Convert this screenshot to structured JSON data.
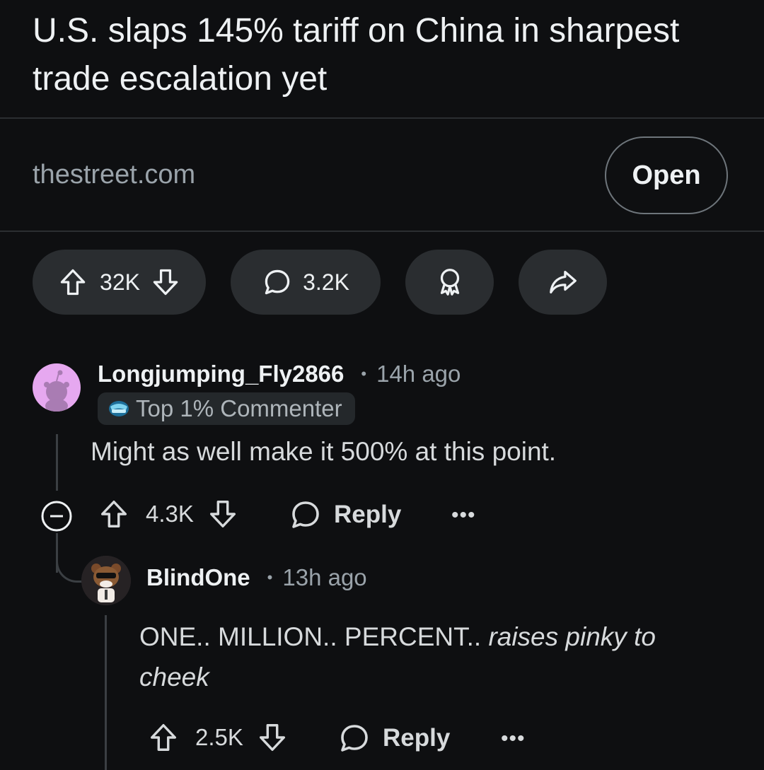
{
  "post": {
    "title": "U.S. slaps 145% tariff on China in sharpest trade escalation yet",
    "domain": "thestreet.com",
    "open_label": "Open",
    "votes": "32K",
    "comments": "3.2K"
  },
  "comments": [
    {
      "username": "Longjumping_Fly2866",
      "time": "14h ago",
      "badge": "Top 1% Commenter",
      "body": "Might as well make it 500% at this point.",
      "votes": "4.3K",
      "reply_label": "Reply",
      "more": "•••"
    },
    {
      "username": "BlindOne",
      "time": "13h ago",
      "body_plain": "ONE.. MILLION.. PERCENT.. ",
      "body_italic_1": "raises pinky to",
      "body_italic_2": "cheek",
      "votes": "2.5K",
      "reply_label": "Reply",
      "more": "•••"
    }
  ],
  "colors": {
    "background": "#0e0f11",
    "pill": "#2a2d30",
    "avatar1_bg": "#e6a8f0",
    "badge_icon": "#7fd4f0"
  },
  "icons": [
    "upvote-icon",
    "downvote-icon",
    "comment-icon",
    "award-icon",
    "share-icon",
    "collapse-icon",
    "ellipsis-icon",
    "snoo-avatar",
    "commenter-badge-icon"
  ]
}
